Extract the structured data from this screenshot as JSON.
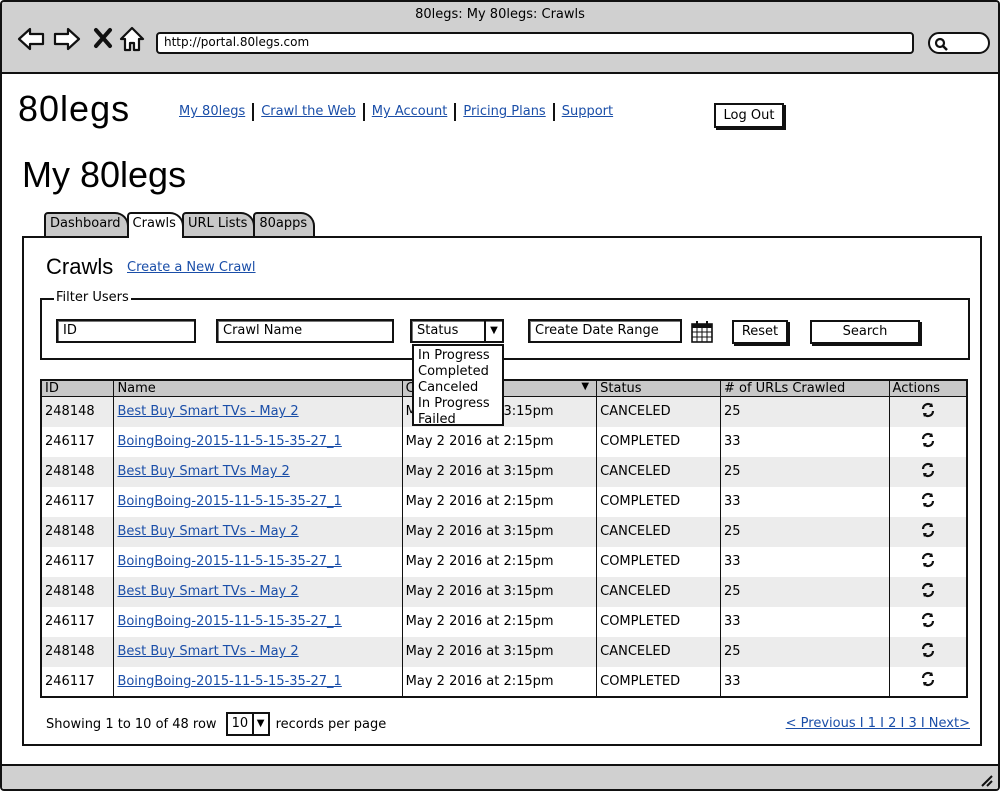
{
  "window": {
    "title": "80legs: My 80legs: Crawls",
    "url": "http://portal.80legs.com"
  },
  "app": {
    "logo": "80legs"
  },
  "nav": {
    "items": [
      "My 80legs",
      "Crawl the Web",
      "My Account",
      "Pricing Plans",
      "Support"
    ],
    "logout": "Log Out"
  },
  "page": {
    "title": "My 80legs"
  },
  "tabs": [
    "Dashboard",
    "Crawls",
    "URL Lists",
    "80apps"
  ],
  "crawls": {
    "title": "Crawls",
    "create_link": "Create a New Crawl"
  },
  "filter": {
    "legend": "Filter Users",
    "id_placeholder": "ID",
    "name_placeholder": "Crawl Name",
    "status_value": "Status",
    "date_placeholder": "Create Date Range",
    "reset": "Reset",
    "search": "Search",
    "status_options": [
      "In Progress",
      "Completed",
      "Canceled",
      "In Progress",
      "Failed"
    ]
  },
  "table": {
    "headers": [
      "ID",
      "Name",
      "C",
      "Status",
      "# of URLs Crawled",
      "Actions"
    ],
    "rows": [
      {
        "id": "248148",
        "name": "Best Buy Smart TVs - May 2",
        "date": "May 2 2016 at 3:15pm",
        "status": "CANCELED",
        "urls": "25"
      },
      {
        "id": "246117",
        "name": "BoingBoing-2015-11-5-15-35-27_1",
        "date": "May 2 2016 at 2:15pm",
        "status": "COMPLETED",
        "urls": "33"
      },
      {
        "id": "248148",
        "name": "Best Buy Smart TVs May 2",
        "date": "May 2 2016 at 3:15pm",
        "status": "CANCELED",
        "urls": "25"
      },
      {
        "id": "246117",
        "name": "BoingBoing-2015-11-5-15-35-27_1",
        "date": "May 2 2016 at 2:15pm",
        "status": "COMPLETED",
        "urls": "33"
      },
      {
        "id": "248148",
        "name": "Best Buy Smart TVs - May 2",
        "date": "May 2 2016 at 3:15pm",
        "status": "CANCELED",
        "urls": "25"
      },
      {
        "id": "246117",
        "name": "BoingBoing-2015-11-5-15-35-27_1",
        "date": "May 2 2016 at 2:15pm",
        "status": "COMPLETED",
        "urls": "33"
      },
      {
        "id": "248148",
        "name": "Best Buy Smart TVs - May 2",
        "date": "May 2 2016 at 3:15pm",
        "status": "CANCELED",
        "urls": "25"
      },
      {
        "id": "246117",
        "name": "BoingBoing-2015-11-5-15-35-27_1",
        "date": "May 2 2016 at 2:15pm",
        "status": "COMPLETED",
        "urls": "33"
      },
      {
        "id": "248148",
        "name": "Best Buy Smart TVs - May 2",
        "date": "May 2 2016 at 3:15pm",
        "status": "CANCELED",
        "urls": "25"
      },
      {
        "id": "246117",
        "name": "BoingBoing-2015-11-5-15-35-27_1",
        "date": "May 2 2016 at 2:15pm",
        "status": "COMPLETED",
        "urls": "33"
      }
    ],
    "action_icon": "refresh-icon"
  },
  "footer": {
    "showing": "Showing 1 to 10 of 48 row",
    "per_page_value": "10",
    "per_page_label": "records per page",
    "pager": "< Previous I 1 I 2 I 3 I Next>"
  },
  "colors": {
    "link": "#1a4ea8",
    "chrome": "#d0d0d0",
    "header": "#c8c8c8"
  }
}
